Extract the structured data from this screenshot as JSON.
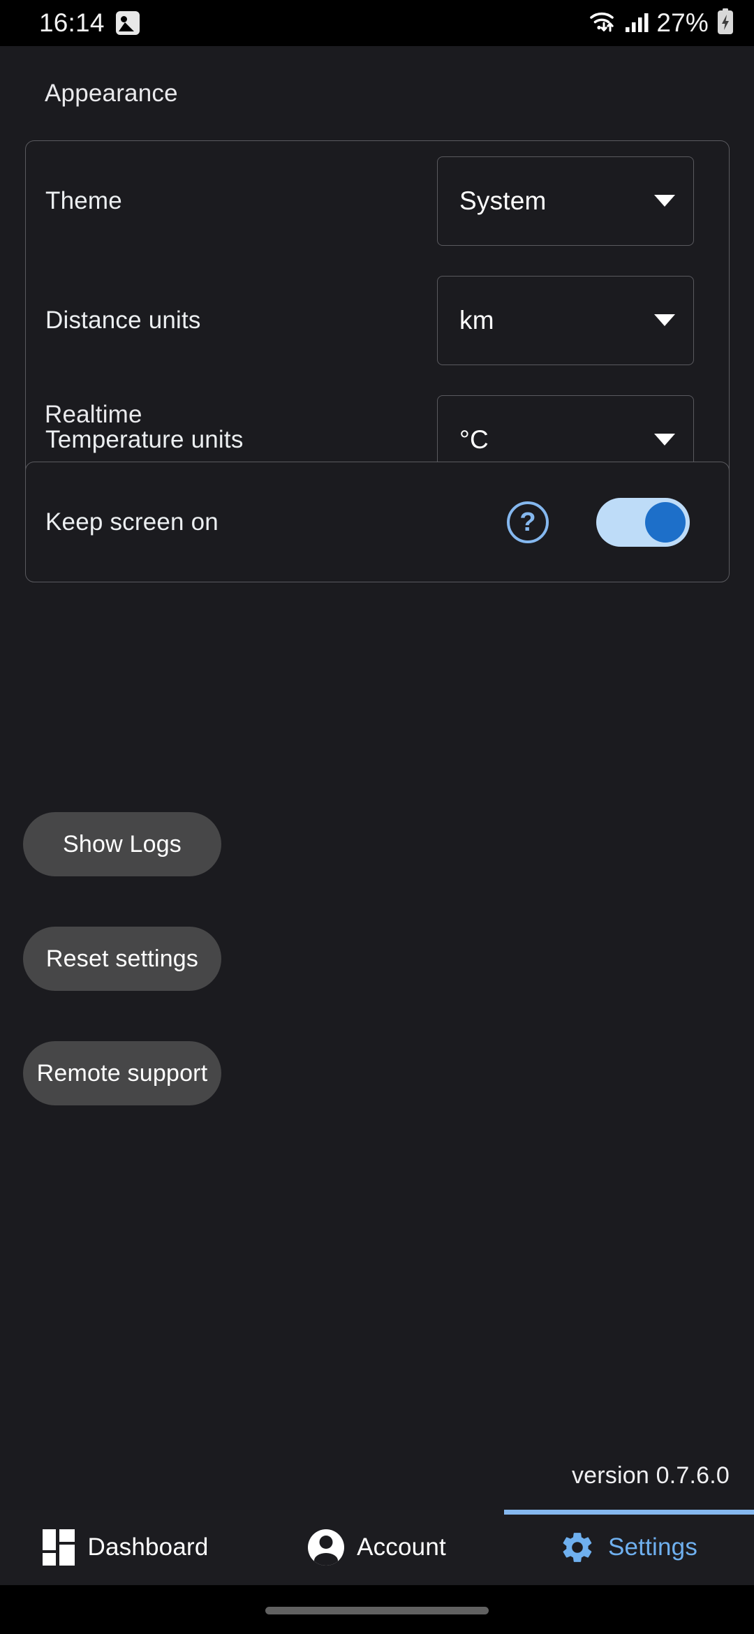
{
  "status_bar": {
    "time": "16:14",
    "screenshot_icon": "image-icon",
    "wifi_icon": "wifi-icon",
    "signal_icon": "cellular-signal-icon",
    "battery_percent": "27%",
    "battery_icon": "battery-charging-icon"
  },
  "sections": {
    "appearance": {
      "title": "Appearance",
      "rows": [
        {
          "label": "Theme",
          "value": "System"
        },
        {
          "label": "Distance units",
          "value": "km"
        },
        {
          "label": "Temperature units",
          "value": "°C"
        }
      ]
    },
    "realtime": {
      "title": "Realtime",
      "row": {
        "label": "Keep screen on",
        "help_icon": "help-circle-icon",
        "toggle_state": "on"
      }
    }
  },
  "actions": [
    {
      "label": "Show Logs"
    },
    {
      "label": "Reset settings"
    },
    {
      "label": "Remote support"
    }
  ],
  "version": "version 0.7.6.0",
  "bottom_nav": {
    "items": [
      {
        "label": "Dashboard",
        "icon": "dashboard-icon",
        "active": false
      },
      {
        "label": "Account",
        "icon": "account-icon",
        "active": false
      },
      {
        "label": "Settings",
        "icon": "gear-icon",
        "active": true
      }
    ]
  },
  "colors": {
    "background": "#1b1b1f",
    "accent": "#85b8ef",
    "toggle_track": "#bedcf8",
    "toggle_thumb": "#1d6fc9",
    "button": "#474748",
    "border": "#5a5a5f"
  }
}
